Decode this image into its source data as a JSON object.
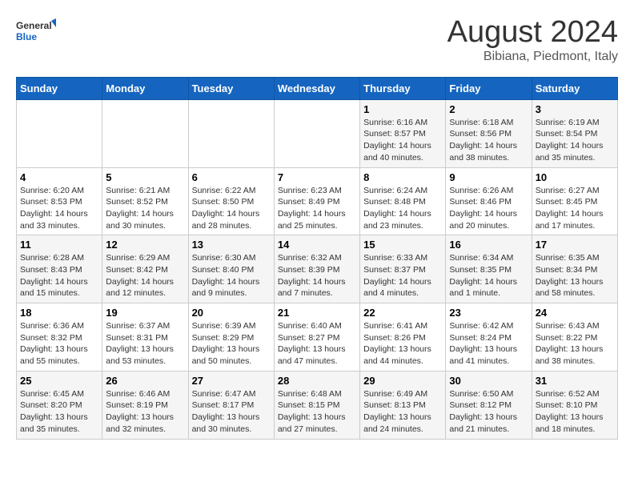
{
  "header": {
    "logo_general": "General",
    "logo_blue": "Blue",
    "month_year": "August 2024",
    "location": "Bibiana, Piedmont, Italy"
  },
  "days_of_week": [
    "Sunday",
    "Monday",
    "Tuesday",
    "Wednesday",
    "Thursday",
    "Friday",
    "Saturday"
  ],
  "weeks": [
    [
      {
        "day": "",
        "info": ""
      },
      {
        "day": "",
        "info": ""
      },
      {
        "day": "",
        "info": ""
      },
      {
        "day": "",
        "info": ""
      },
      {
        "day": "1",
        "info": "Sunrise: 6:16 AM\nSunset: 8:57 PM\nDaylight: 14 hours and 40 minutes."
      },
      {
        "day": "2",
        "info": "Sunrise: 6:18 AM\nSunset: 8:56 PM\nDaylight: 14 hours and 38 minutes."
      },
      {
        "day": "3",
        "info": "Sunrise: 6:19 AM\nSunset: 8:54 PM\nDaylight: 14 hours and 35 minutes."
      }
    ],
    [
      {
        "day": "4",
        "info": "Sunrise: 6:20 AM\nSunset: 8:53 PM\nDaylight: 14 hours and 33 minutes."
      },
      {
        "day": "5",
        "info": "Sunrise: 6:21 AM\nSunset: 8:52 PM\nDaylight: 14 hours and 30 minutes."
      },
      {
        "day": "6",
        "info": "Sunrise: 6:22 AM\nSunset: 8:50 PM\nDaylight: 14 hours and 28 minutes."
      },
      {
        "day": "7",
        "info": "Sunrise: 6:23 AM\nSunset: 8:49 PM\nDaylight: 14 hours and 25 minutes."
      },
      {
        "day": "8",
        "info": "Sunrise: 6:24 AM\nSunset: 8:48 PM\nDaylight: 14 hours and 23 minutes."
      },
      {
        "day": "9",
        "info": "Sunrise: 6:26 AM\nSunset: 8:46 PM\nDaylight: 14 hours and 20 minutes."
      },
      {
        "day": "10",
        "info": "Sunrise: 6:27 AM\nSunset: 8:45 PM\nDaylight: 14 hours and 17 minutes."
      }
    ],
    [
      {
        "day": "11",
        "info": "Sunrise: 6:28 AM\nSunset: 8:43 PM\nDaylight: 14 hours and 15 minutes."
      },
      {
        "day": "12",
        "info": "Sunrise: 6:29 AM\nSunset: 8:42 PM\nDaylight: 14 hours and 12 minutes."
      },
      {
        "day": "13",
        "info": "Sunrise: 6:30 AM\nSunset: 8:40 PM\nDaylight: 14 hours and 9 minutes."
      },
      {
        "day": "14",
        "info": "Sunrise: 6:32 AM\nSunset: 8:39 PM\nDaylight: 14 hours and 7 minutes."
      },
      {
        "day": "15",
        "info": "Sunrise: 6:33 AM\nSunset: 8:37 PM\nDaylight: 14 hours and 4 minutes."
      },
      {
        "day": "16",
        "info": "Sunrise: 6:34 AM\nSunset: 8:35 PM\nDaylight: 14 hours and 1 minute."
      },
      {
        "day": "17",
        "info": "Sunrise: 6:35 AM\nSunset: 8:34 PM\nDaylight: 13 hours and 58 minutes."
      }
    ],
    [
      {
        "day": "18",
        "info": "Sunrise: 6:36 AM\nSunset: 8:32 PM\nDaylight: 13 hours and 55 minutes."
      },
      {
        "day": "19",
        "info": "Sunrise: 6:37 AM\nSunset: 8:31 PM\nDaylight: 13 hours and 53 minutes."
      },
      {
        "day": "20",
        "info": "Sunrise: 6:39 AM\nSunset: 8:29 PM\nDaylight: 13 hours and 50 minutes."
      },
      {
        "day": "21",
        "info": "Sunrise: 6:40 AM\nSunset: 8:27 PM\nDaylight: 13 hours and 47 minutes."
      },
      {
        "day": "22",
        "info": "Sunrise: 6:41 AM\nSunset: 8:26 PM\nDaylight: 13 hours and 44 minutes."
      },
      {
        "day": "23",
        "info": "Sunrise: 6:42 AM\nSunset: 8:24 PM\nDaylight: 13 hours and 41 minutes."
      },
      {
        "day": "24",
        "info": "Sunrise: 6:43 AM\nSunset: 8:22 PM\nDaylight: 13 hours and 38 minutes."
      }
    ],
    [
      {
        "day": "25",
        "info": "Sunrise: 6:45 AM\nSunset: 8:20 PM\nDaylight: 13 hours and 35 minutes."
      },
      {
        "day": "26",
        "info": "Sunrise: 6:46 AM\nSunset: 8:19 PM\nDaylight: 13 hours and 32 minutes."
      },
      {
        "day": "27",
        "info": "Sunrise: 6:47 AM\nSunset: 8:17 PM\nDaylight: 13 hours and 30 minutes."
      },
      {
        "day": "28",
        "info": "Sunrise: 6:48 AM\nSunset: 8:15 PM\nDaylight: 13 hours and 27 minutes."
      },
      {
        "day": "29",
        "info": "Sunrise: 6:49 AM\nSunset: 8:13 PM\nDaylight: 13 hours and 24 minutes."
      },
      {
        "day": "30",
        "info": "Sunrise: 6:50 AM\nSunset: 8:12 PM\nDaylight: 13 hours and 21 minutes."
      },
      {
        "day": "31",
        "info": "Sunrise: 6:52 AM\nSunset: 8:10 PM\nDaylight: 13 hours and 18 minutes."
      }
    ]
  ]
}
